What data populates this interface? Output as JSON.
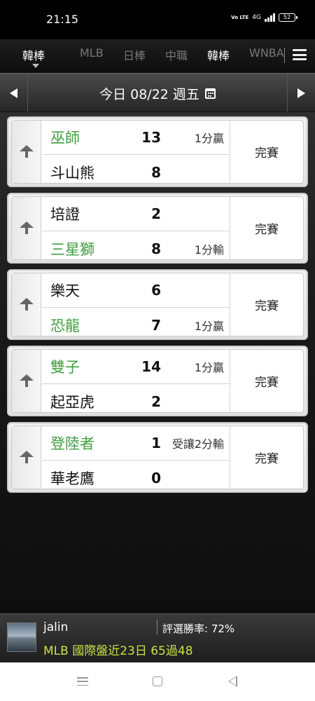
{
  "status_bar": {
    "time": "21:15",
    "volte": "Vo LTE",
    "network": "4G",
    "battery": "52"
  },
  "tabs": [
    {
      "label": "韓棒",
      "active": true
    },
    {
      "label": "MLB",
      "active": false
    },
    {
      "label": "日棒",
      "active": false
    },
    {
      "label": "中職",
      "active": false
    },
    {
      "label": "韓棒",
      "active": false
    },
    {
      "label": "WNBA",
      "active": false
    }
  ],
  "date_bar": {
    "label": "今日 08/22 週五"
  },
  "games": [
    {
      "status": "完賽",
      "team1": {
        "name": "巫師",
        "score": "13",
        "result": "1分贏",
        "highlight": true
      },
      "team2": {
        "name": "斗山熊",
        "score": "8",
        "result": "",
        "highlight": false
      }
    },
    {
      "status": "完賽",
      "team1": {
        "name": "培證",
        "score": "2",
        "result": "",
        "highlight": false
      },
      "team2": {
        "name": "三星獅",
        "score": "8",
        "result": "1分輸",
        "highlight": true
      }
    },
    {
      "status": "完賽",
      "team1": {
        "name": "樂天",
        "score": "6",
        "result": "",
        "highlight": false
      },
      "team2": {
        "name": "恐龍",
        "score": "7",
        "result": "1分贏",
        "highlight": true
      }
    },
    {
      "status": "完賽",
      "team1": {
        "name": "雙子",
        "score": "14",
        "result": "1分贏",
        "highlight": true
      },
      "team2": {
        "name": "起亞虎",
        "score": "2",
        "result": "",
        "highlight": false
      }
    },
    {
      "status": "完賽",
      "team1": {
        "name": "登陸者",
        "score": "1",
        "result": "受讓2分輸",
        "highlight": true
      },
      "team2": {
        "name": "華老鷹",
        "score": "0",
        "result": "",
        "highlight": false
      }
    }
  ],
  "user": {
    "name": "jalin",
    "win_rate": "評選勝率: 72%",
    "record": "MLB 國際盤近23日 65過48"
  },
  "colors": {
    "highlight_team": "#3f9f3f",
    "record_text": "#c7e246"
  }
}
